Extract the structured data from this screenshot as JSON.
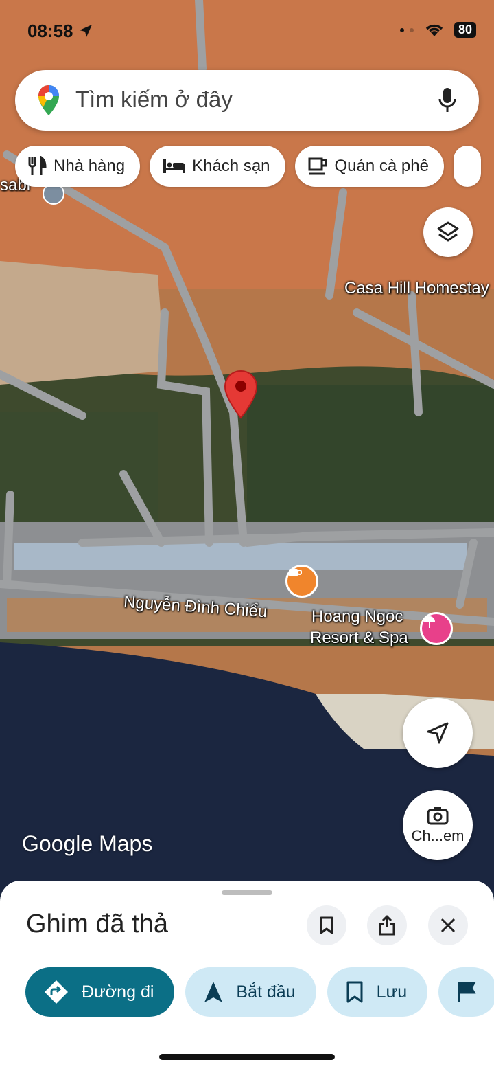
{
  "status": {
    "time": "08:58",
    "battery": "80"
  },
  "search": {
    "placeholder": "Tìm kiếm ở đây"
  },
  "chips": [
    {
      "label": "Nhà hàng",
      "icon": "fork-knife-icon"
    },
    {
      "label": "Khách sạn",
      "icon": "bed-icon"
    },
    {
      "label": "Quán cà phê",
      "icon": "coffee-cup-icon"
    }
  ],
  "map": {
    "labels": {
      "sabi": "sabi",
      "casa": "Casa Hill Homestay",
      "street": "Nguyễn Đình Chiểu",
      "resort_line1": "Hoang Ngoc",
      "resort_line2": "Resort & Spa"
    },
    "camera_button_label": "Ch...em",
    "logo": "Google Maps"
  },
  "sheet": {
    "title": "Ghim đã thả",
    "actions": [
      {
        "label": "Đường đi",
        "icon": "directions-icon"
      },
      {
        "label": "Bắt đầu",
        "icon": "navigation-arrow-icon"
      },
      {
        "label": "Lưu",
        "icon": "bookmark-icon"
      }
    ]
  },
  "colors": {
    "accent": "#0b6f86",
    "action_bg": "#cfe9f5",
    "pin": "#e53935"
  }
}
